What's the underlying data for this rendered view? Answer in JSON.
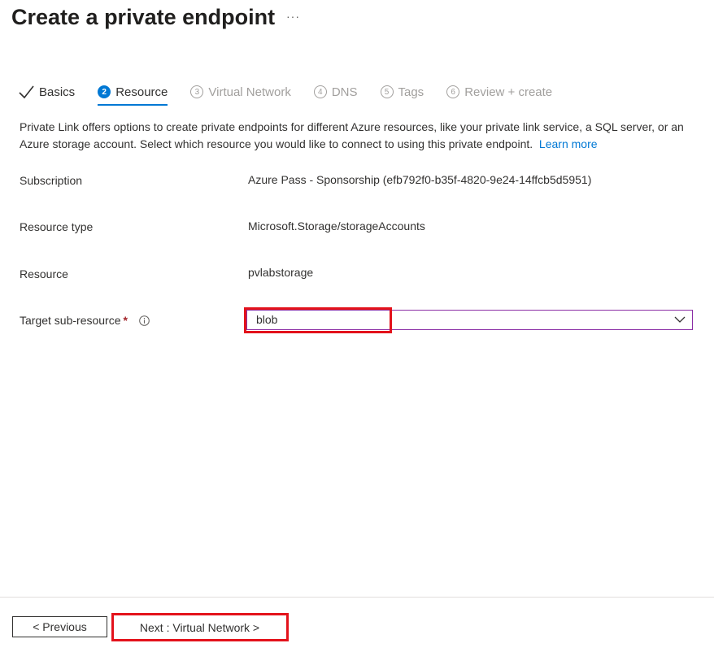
{
  "header": {
    "title": "Create a private endpoint",
    "more_label": "···"
  },
  "tabs": [
    {
      "num": "",
      "label": "Basics",
      "state": "done"
    },
    {
      "num": "2",
      "label": "Resource",
      "state": "active"
    },
    {
      "num": "3",
      "label": "Virtual Network",
      "state": "pending"
    },
    {
      "num": "4",
      "label": "DNS",
      "state": "pending"
    },
    {
      "num": "5",
      "label": "Tags",
      "state": "pending"
    },
    {
      "num": "6",
      "label": "Review + create",
      "state": "pending"
    }
  ],
  "description": {
    "text": "Private Link offers options to create private endpoints for different Azure resources, like your private link service, a SQL server, or an Azure storage account. Select which resource you would like to connect to using this private endpoint.",
    "link": "Learn more"
  },
  "form": {
    "subscription": {
      "label": "Subscription",
      "value": "Azure Pass - Sponsorship (efb792f0-b35f-4820-9e24-14ffcb5d5951)"
    },
    "resource_type": {
      "label": "Resource type",
      "value": "Microsoft.Storage/storageAccounts"
    },
    "resource": {
      "label": "Resource",
      "value": "pvlabstorage"
    },
    "target_sub_resource": {
      "label": "Target sub-resource",
      "required_marker": "*",
      "value": "blob"
    }
  },
  "footer": {
    "previous_label": "< Previous",
    "next_label": "Next : Virtual Network >"
  },
  "colors": {
    "accent": "#0078d4",
    "highlight": "#e3121b",
    "focus_border": "#8a2da5",
    "required": "#a4262c"
  },
  "icons": {
    "more": "more-horizontal-icon",
    "done": "check-icon",
    "info": "info-icon",
    "dropdown": "chevron-down-icon"
  }
}
